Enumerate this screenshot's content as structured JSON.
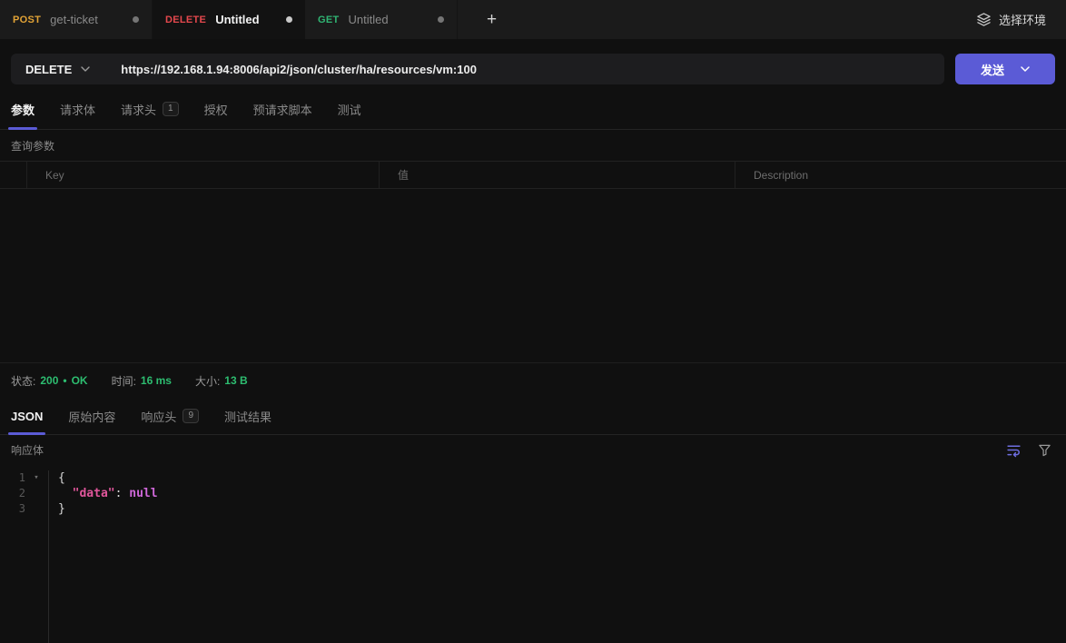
{
  "colors": {
    "accent": "#5b5bd6",
    "method_post": "#e2a336",
    "method_delete": "#e5484d",
    "method_get": "#30b573",
    "status_green": "#2dbd70",
    "json_key": "#e0569b",
    "json_null": "#cf68d9"
  },
  "tabbar": {
    "tabs": [
      {
        "method": "POST",
        "name": "get-ticket"
      },
      {
        "method": "DELETE",
        "name": "Untitled"
      },
      {
        "method": "GET",
        "name": "Untitled"
      }
    ],
    "new_tab_label": "+",
    "env_selector_label": "选择环境"
  },
  "request_bar": {
    "method": "DELETE",
    "url": "https://192.168.1.94:8006/api2/json/cluster/ha/resources/vm:100",
    "send_label": "发送"
  },
  "request_tabs": {
    "params": "参数",
    "body": "请求体",
    "headers": "请求头",
    "headers_badge": "1",
    "auth": "授权",
    "prescript": "预请求脚本",
    "tests": "测试"
  },
  "params_panel": {
    "section_title": "查询参数",
    "col_key": "Key",
    "col_value": "值",
    "col_desc": "Description"
  },
  "response_meta": {
    "status_label": "状态:",
    "status_code": "200",
    "status_sep": "•",
    "status_text": "OK",
    "time_label": "时间:",
    "time_value": "16 ms",
    "size_label": "大小:",
    "size_value": "13 B"
  },
  "response_tabs": {
    "json": "JSON",
    "raw": "原始内容",
    "headers": "响应头",
    "headers_badge": "9",
    "tests": "测试结果"
  },
  "response_panel": {
    "body_title": "响应体",
    "line_numbers": [
      "1",
      "2",
      "3"
    ],
    "fold_arrow": "▾",
    "code": {
      "open_brace": "{",
      "indent": "  ",
      "key": "\"data\"",
      "colon": ": ",
      "value": "null",
      "close_brace": "}"
    }
  }
}
